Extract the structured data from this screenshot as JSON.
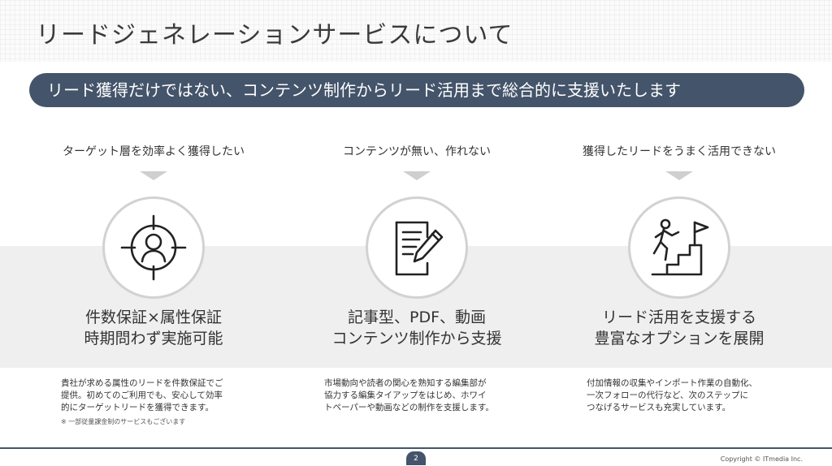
{
  "title": "リードジェネレーションサービスについて",
  "banner": "リード獲得だけではない、コンテンツ制作からリード活用まで総合的に支援いたします",
  "columns": [
    {
      "question": "ターゲット層を効率よく獲得したい",
      "icon": "target-person-icon",
      "headline": [
        "件数保証×属性保証",
        "時期問わず実施可能"
      ],
      "description": [
        "貴社が求める属性のリードを件数保証でご",
        "提供。初めてのご利用でも、安心して効率",
        "的にターゲットリードを獲得できます。"
      ],
      "note": "※ 一部従量課金制のサービスもございます"
    },
    {
      "question": "コンテンツが無い、作れない",
      "icon": "document-pen-icon",
      "headline": [
        "記事型、PDF、動画",
        "コンテンツ制作から支援"
      ],
      "description": [
        "市場動向や読者の関心を熟知する編集部が",
        "協力する編集タイアップをはじめ、ホワイ",
        "トペーパーや動画などの制作を支援します。"
      ]
    },
    {
      "question": "獲得したリードをうまく活用できない",
      "icon": "climb-stairs-flag-icon",
      "headline": [
        "リード活用を支援する",
        "豊富なオプションを展開"
      ],
      "description": [
        "付加情報の収集やインポート作業の自動化、",
        "一次フォローの代行など、次のステップに",
        "つなげるサービスも充実しています。"
      ]
    }
  ],
  "footer": {
    "page_number": "2",
    "copyright": "Copyright © ITmedia Inc."
  },
  "colors": {
    "accent": "#44546a",
    "band": "#efefef"
  }
}
